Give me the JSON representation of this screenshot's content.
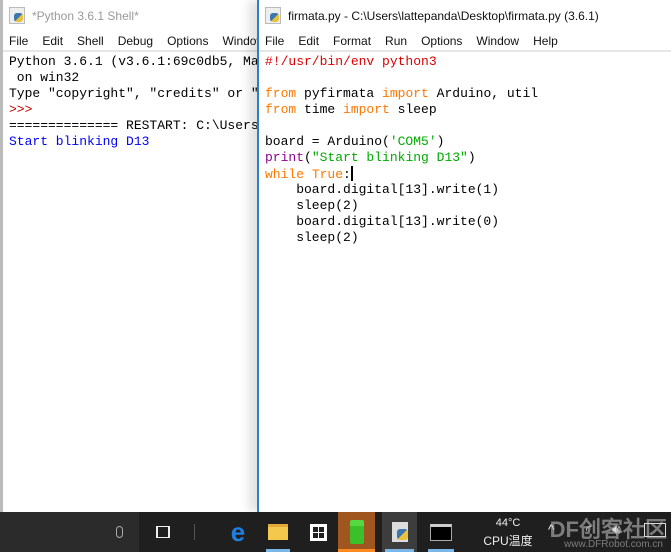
{
  "shell": {
    "title": "*Python 3.6.1 Shell*",
    "menu": [
      "File",
      "Edit",
      "Shell",
      "Debug",
      "Options",
      "Window"
    ],
    "lines": [
      [
        [
          "Python 3.6.1 (v3.6.1:69c0db5, Ma",
          "tx"
        ]
      ],
      [
        [
          " on win32",
          "tx"
        ]
      ],
      [
        [
          "Type \"copyright\", \"credits\" or \"",
          "tx"
        ]
      ],
      [
        [
          ">>> ",
          "pr"
        ]
      ],
      [
        [
          "============== RESTART: C:\\Users",
          "tx"
        ]
      ],
      [
        [
          "Start blinking D13",
          "out"
        ]
      ]
    ]
  },
  "editor": {
    "title": "firmata.py - C:\\Users\\lattepanda\\Desktop\\firmata.py (3.6.1)",
    "menu": [
      "File",
      "Edit",
      "Format",
      "Run",
      "Options",
      "Window",
      "Help"
    ],
    "lines": [
      [
        [
          "#!/usr/bin/env python3",
          "cm"
        ]
      ],
      [],
      [
        [
          "from",
          "kw"
        ],
        [
          " pyfirmata ",
          "tx"
        ],
        [
          "import",
          "kw"
        ],
        [
          " Arduino, util",
          "tx"
        ]
      ],
      [
        [
          "from",
          "kw"
        ],
        [
          " time ",
          "tx"
        ],
        [
          "import",
          "kw"
        ],
        [
          " sleep",
          "tx"
        ]
      ],
      [],
      [
        [
          "board = Arduino(",
          "tx"
        ],
        [
          "'COM5'",
          "st"
        ],
        [
          ")",
          "tx"
        ]
      ],
      [
        [
          "print",
          "bi"
        ],
        [
          "(",
          "tx"
        ],
        [
          "\"Start blinking D13\"",
          "st"
        ],
        [
          ")",
          "tx"
        ]
      ],
      [
        [
          "while",
          "kw"
        ],
        [
          " ",
          "tx"
        ],
        [
          "True",
          "kw"
        ],
        [
          ":",
          "tx"
        ]
      ],
      [
        [
          "    board.digital[13].write(1)",
          "tx"
        ]
      ],
      [
        [
          "    sleep(2)",
          "tx"
        ]
      ],
      [
        [
          "    board.digital[13].write(0)",
          "tx"
        ]
      ],
      [
        [
          "    sleep(2)",
          "tx"
        ]
      ]
    ]
  },
  "taskbar": {
    "icons": [
      "microphone-icon",
      "task-view-icon",
      "edge-icon",
      "file-explorer-icon",
      "store-icon",
      "green-pipe-app-icon",
      "python-idle-icon",
      "command-prompt-icon"
    ],
    "temperature": "44°C",
    "cpu_label": "CPU温度",
    "active_app_color": "#a0561f",
    "watermark": "DF创客社区",
    "watermark_url": "www.DFRobot.com.cn"
  }
}
